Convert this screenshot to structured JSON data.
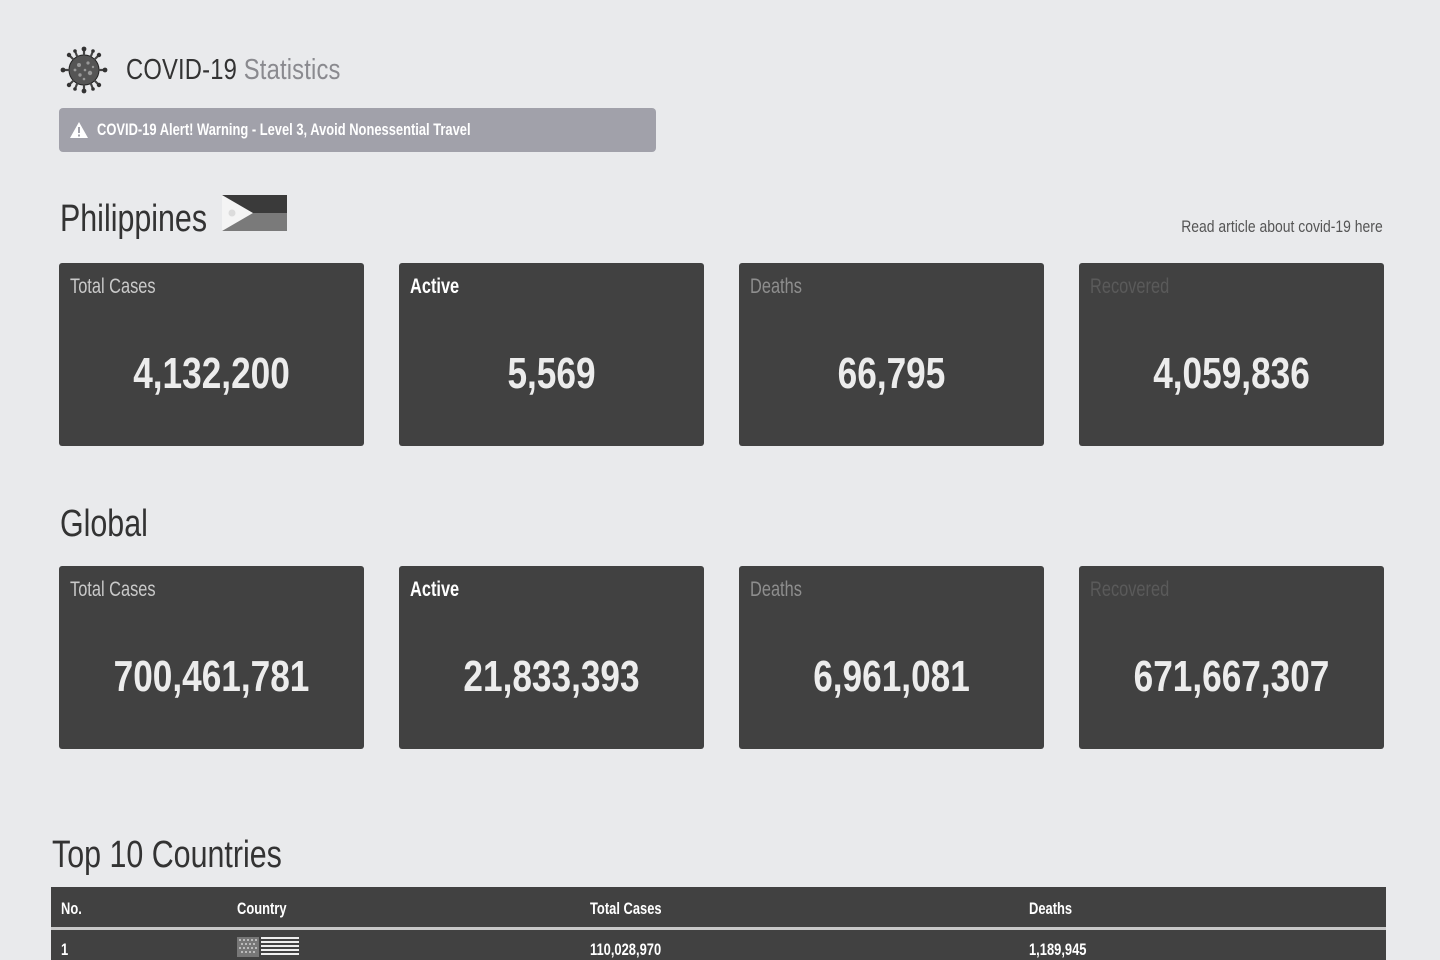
{
  "header": {
    "title_main": "COVID-19",
    "title_accent": "Statistics",
    "logo_icon": "virus-icon"
  },
  "alert": {
    "icon": "warning-triangle-icon",
    "text": "COVID-19 Alert! Warning - Level 3, Avoid Nonessential Travel"
  },
  "philippines": {
    "title": "Philippines",
    "flag_icon": "philippines-flag-icon",
    "article_link": "Read article about covid-19 here",
    "cards": [
      {
        "label": "Total Cases",
        "value": "4,132,200"
      },
      {
        "label": "Active",
        "value": "5,569"
      },
      {
        "label": "Deaths",
        "value": "66,795"
      },
      {
        "label": "Recovered",
        "value": "4,059,836"
      }
    ]
  },
  "global": {
    "title": "Global",
    "cards": [
      {
        "label": "Total Cases",
        "value": "700,461,781"
      },
      {
        "label": "Active",
        "value": "21,833,393"
      },
      {
        "label": "Deaths",
        "value": "6,961,081"
      },
      {
        "label": "Recovered",
        "value": "671,667,307"
      }
    ]
  },
  "top10": {
    "title": "Top 10 Countries",
    "columns": [
      "No.",
      "Country",
      "Total Cases",
      "Deaths"
    ],
    "rows": [
      {
        "no": "1",
        "flag_icon": "usa-flag-icon",
        "total_cases": "110,028,970",
        "deaths": "1,189,945"
      }
    ]
  },
  "colors": {
    "background": "#e9eaec",
    "card": "#414141",
    "alert": "#a1a1aa",
    "accent_text": "#8a8a8f"
  }
}
